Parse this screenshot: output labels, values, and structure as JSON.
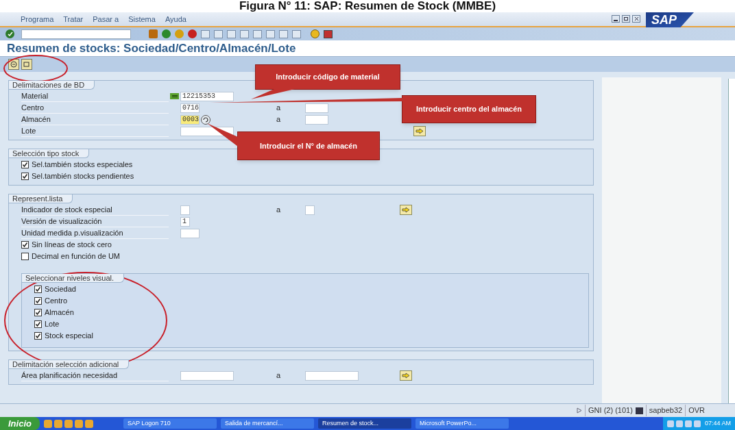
{
  "caption": "Figura N° 11: SAP: Resumen de Stock (MMBE)",
  "menu": [
    "Programa",
    "Tratar",
    "Pasar a",
    "Sistema",
    "Ayuda"
  ],
  "title": "Resumen de stocks: Sociedad/Centro/Almacén/Lote",
  "sections": [
    {
      "title": "Delimitaciones de BD",
      "rows": [
        {
          "kind": "field",
          "label": "Material",
          "value": "12215353",
          "indicator": true,
          "focused": false,
          "range": false,
          "more": false,
          "wide": true
        },
        {
          "kind": "field",
          "label": "Centro",
          "value": "0716",
          "indicator": false,
          "focused": false,
          "range": true,
          "range_label": "a",
          "more": false,
          "wide": false
        },
        {
          "kind": "field",
          "label": "Almacén",
          "value": "0003",
          "indicator": false,
          "focused": true,
          "range": true,
          "range_label": "a",
          "more": false,
          "wide": false
        },
        {
          "kind": "field",
          "label": "Lote",
          "indicator": false,
          "focused": false,
          "range": false,
          "more": true,
          "wide": true
        }
      ]
    },
    {
      "title": "Selección tipo stock",
      "rows": [
        {
          "kind": "checkbox",
          "label": "Sel.también stocks especiales",
          "checked": true
        },
        {
          "kind": "checkbox",
          "label": "Sel.también stocks pendientes",
          "checked": true
        }
      ]
    },
    {
      "title": "Represent.lista",
      "rows": [
        {
          "kind": "field",
          "label": "Indicador de stock especial",
          "indicator": false,
          "focused": false,
          "range": true,
          "range_label": "a",
          "more": true,
          "wide": false,
          "narrow": true
        },
        {
          "kind": "field",
          "label": "Versión de visualización",
          "value": "1",
          "indicator": false,
          "focused": false,
          "range": false,
          "more": false,
          "wide": false,
          "narrow": true
        },
        {
          "kind": "field",
          "label": "Unidad medida p.visualización",
          "indicator": false,
          "focused": false,
          "range": false,
          "more": false,
          "wide": false
        },
        {
          "kind": "checkbox",
          "label": "Sin líneas de stock cero",
          "checked": true
        },
        {
          "kind": "checkbox",
          "label": "Decimal en función de UM",
          "checked": false
        }
      ],
      "group": {
        "title": "Seleccionar niveles visual.",
        "rows": [
          {
            "kind": "checkbox",
            "label": "Sociedad",
            "checked": true
          },
          {
            "kind": "checkbox",
            "label": "Centro",
            "checked": true
          },
          {
            "kind": "checkbox",
            "label": "Almacén",
            "checked": true
          },
          {
            "kind": "checkbox",
            "label": "Lote",
            "checked": true
          },
          {
            "kind": "checkbox",
            "label": "Stock especial",
            "checked": true
          }
        ]
      }
    },
    {
      "title": "Delimitación selección adicional",
      "rows": [
        {
          "kind": "field",
          "label": "Área planificación necesidad",
          "indicator": false,
          "focused": false,
          "range": true,
          "range_label": "a",
          "more": true,
          "wide": true
        }
      ]
    }
  ],
  "logo": "SAP",
  "callouts": [
    "Introducir código de material",
    "Introducir  centro del almacén",
    "Introducir el N° de almacén"
  ],
  "status_bar": [
    "GNI (2) (101)",
    "sapbeb32",
    "OVR"
  ],
  "taskbar": {
    "start": "Inicio",
    "tasks": [
      {
        "label": "SAP Logon 710",
        "selected": false
      },
      {
        "label": "Salida de mercancí...",
        "selected": false
      },
      {
        "label": "Resumen de stock...",
        "selected": true
      },
      {
        "label": "Microsoft PowerPo...",
        "selected": false
      }
    ],
    "clock": "07:44 AM"
  }
}
